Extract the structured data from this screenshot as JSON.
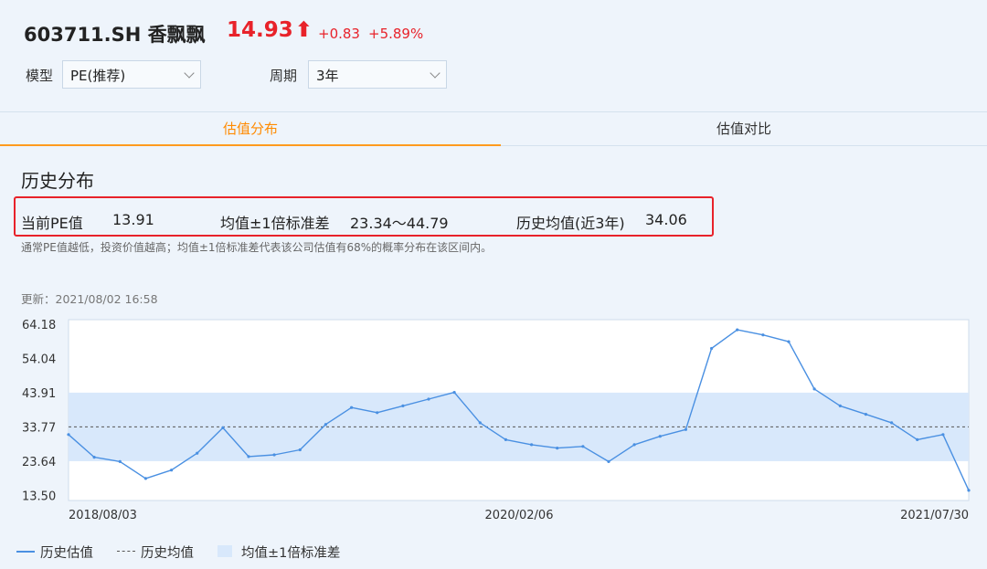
{
  "header": {
    "stock": "603711.SH 香飘飘",
    "price": "14.93",
    "price_arrow": "⬆",
    "change_abs": "+0.83",
    "change_pct": "+5.89%",
    "up_color": "#e8222a"
  },
  "filters": {
    "model_label": "模型",
    "model_value": "PE(推荐)",
    "period_label": "周期",
    "period_value": "3年"
  },
  "tabs": [
    {
      "label": "估值分布",
      "active": true
    },
    {
      "label": "估值对比",
      "active": false
    }
  ],
  "section": {
    "title": "历史分布",
    "current_label": "当前PE值",
    "current_value": "13.91",
    "band_label": "均值±1倍标准差",
    "band_value": "23.34～44.79",
    "mean_label": "历史均值(近3年)",
    "mean_value": "34.06",
    "note": "通常PE值越低，投资价值越高；均值±1倍标准差代表该公司估值有68%的概率分布在该区间内。",
    "updated": "更新：2021/08/02 16:58"
  },
  "legend": {
    "series": "历史估值",
    "mean": "历史均值",
    "band": "均值±1倍标准差"
  },
  "chart_data": {
    "type": "line",
    "x_tick_labels": [
      "2018/08/03",
      "2020/02/06",
      "2021/07/30"
    ],
    "y_tick_labels": [
      "64.18",
      "54.04",
      "43.91",
      "33.77",
      "23.64",
      "13.50"
    ],
    "ylim": [
      12.0,
      65.5
    ],
    "mean": 33.77,
    "band": [
      23.64,
      43.91
    ],
    "colors": {
      "line": "#4a90e2",
      "band": "#d8e8fb",
      "mean": "#555555"
    },
    "series": [
      {
        "x": [
          "2018/08",
          "2018/09",
          "2018/10",
          "2018/11",
          "2018/12",
          "2019/01",
          "2019/02",
          "2019/03",
          "2019/04",
          "2019/05",
          "2019/06",
          "2019/07",
          "2019/08",
          "2019/09",
          "2019/10",
          "2019/11",
          "2019/12",
          "2020/01",
          "2020/02",
          "2020/03",
          "2020/04",
          "2020/05",
          "2020/06",
          "2020/07",
          "2020/08",
          "2020/09",
          "2020/10",
          "2020/11",
          "2020/12",
          "2021/01",
          "2021/02",
          "2021/03",
          "2021/04",
          "2021/05",
          "2021/06",
          "2021/07"
        ],
        "values": [
          31.5,
          24.8,
          23.5,
          18.5,
          21.0,
          26.0,
          33.5,
          25.0,
          25.5,
          27.0,
          34.5,
          39.5,
          38.0,
          40.0,
          42.0,
          44.0,
          35.0,
          30.0,
          28.5,
          27.5,
          28.0,
          23.5,
          28.5,
          31.0,
          33.0,
          57.0,
          62.5,
          61.0,
          59.0,
          45.0,
          40.0,
          37.5,
          35.0,
          30.0,
          31.5,
          15.0
        ]
      }
    ]
  }
}
